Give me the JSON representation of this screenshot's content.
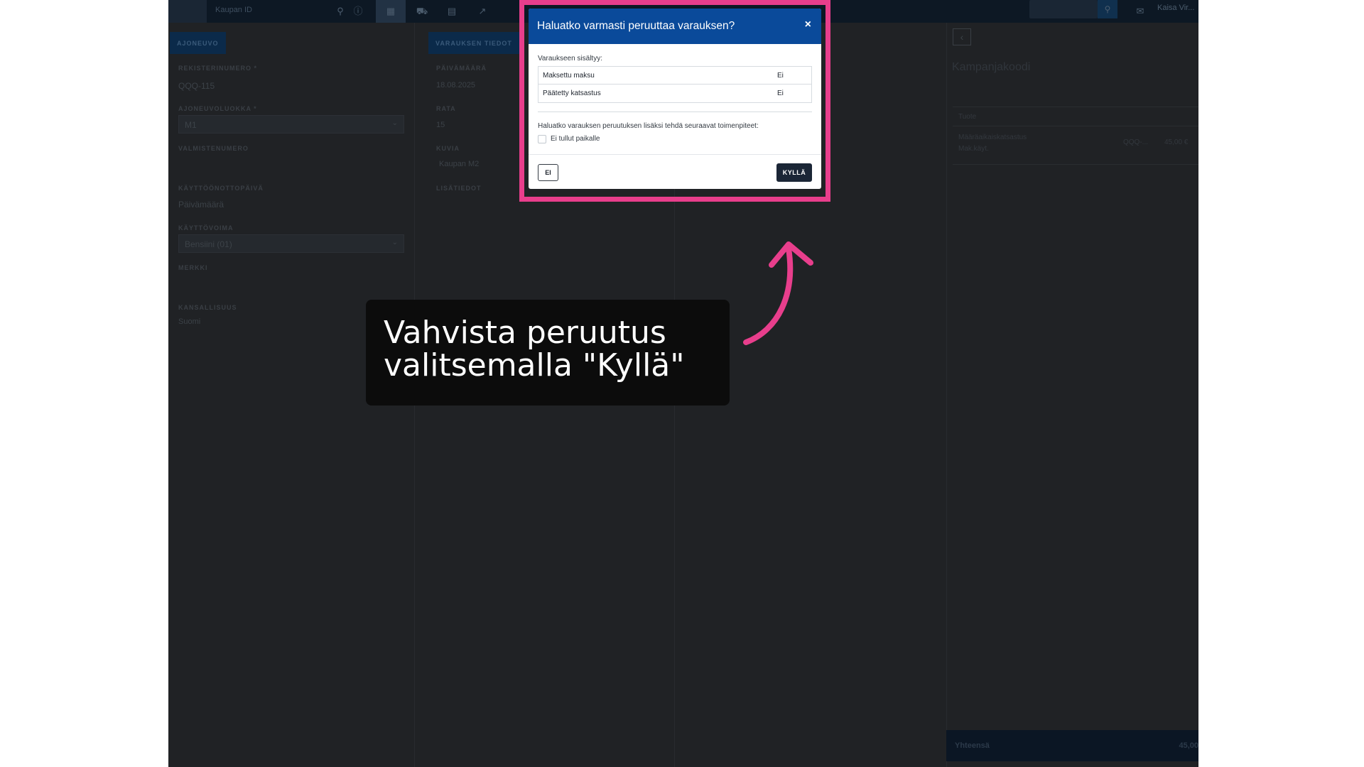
{
  "topbar": {
    "search_placeholder": "Kaupan ID",
    "user_label": "Kaisa Vir..."
  },
  "left_panel": {
    "tab_label": "AJONEUVO",
    "fields": [
      {
        "label": "REKISTERINUMERO *",
        "value": "QQQ-115"
      },
      {
        "label": "AJONEUVOLUOKKA *",
        "value": "M1"
      },
      {
        "label": "VALMISTENUMERO",
        "value": ""
      },
      {
        "label": "KÄYTTÖÖNOTTOPÄIVÄ",
        "value": "Päivämäärä"
      },
      {
        "label": "KÄYTTÖVOIMA",
        "value": "Bensiini (01)"
      },
      {
        "label": "MERKKI",
        "value": ""
      },
      {
        "label": "KANSALLISUUS",
        "value": "Suomi"
      }
    ]
  },
  "middle_panel": {
    "tab_label": "VARAUKSEN TIEDOT",
    "fields": [
      {
        "label": "PÄIVÄMÄÄRÄ",
        "value": "18.08.2025"
      },
      {
        "label": "RATA",
        "value": "15"
      },
      {
        "label": "KUVIA",
        "value": "Kaupan M2"
      },
      {
        "label": "LISÄTIEDOT",
        "value": ""
      }
    ]
  },
  "right_panel": {
    "title": "Kampanjakoodi",
    "table_header": "Tuote",
    "item_name": "Määräaikaiskatsastus",
    "item_sub": "Mak.käyt.",
    "item_code": "QQQ-...",
    "item_price": "45,00 €",
    "footer_label": "Yhteensä",
    "footer_value": "45,00"
  },
  "modal": {
    "title": "Haluatko varmasti peruuttaa varauksen?",
    "close_symbol": "×",
    "included_label": "Varaukseen sisältyy:",
    "items": [
      {
        "name": "Maksettu maksu",
        "value": "Ei"
      },
      {
        "name": "Päätetty katsastus",
        "value": "Ei"
      }
    ],
    "question": "Haluatko varauksen peruutuksen lisäksi tehdä seuraavat toimenpiteet:",
    "checkbox_label": "Ei tullut paikalle",
    "cancel_label": "EI",
    "confirm_label": "KYLLÄ"
  },
  "callout": {
    "line1": "Vahvista peruutus",
    "line2": "valitsemalla \"Kyllä\""
  },
  "colors": {
    "highlight": "#e83e8c",
    "modal_header": "#0a4a9a",
    "confirm_button": "#1b2636",
    "callout_bg": "#0c0c0c"
  }
}
